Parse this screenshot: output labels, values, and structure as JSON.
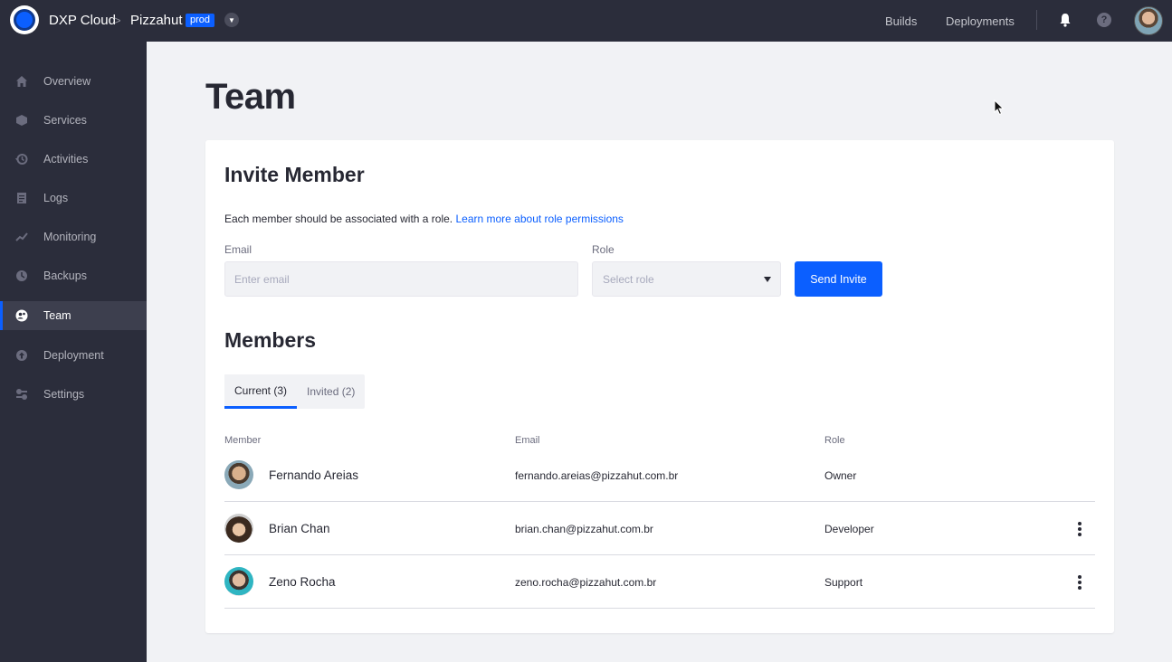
{
  "topbar": {
    "brand": "DXP Cloud",
    "separator": ">",
    "project": "Pizzahut",
    "env_badge": "prod",
    "links": [
      "Builds",
      "Deployments"
    ],
    "help_glyph": "?"
  },
  "sidebar": {
    "items": [
      {
        "label": "Overview",
        "icon": "home-icon"
      },
      {
        "label": "Services",
        "icon": "cube-icon"
      },
      {
        "label": "Activities",
        "icon": "history-icon"
      },
      {
        "label": "Logs",
        "icon": "list-icon"
      },
      {
        "label": "Monitoring",
        "icon": "chart-line-icon"
      },
      {
        "label": "Backups",
        "icon": "backup-icon"
      },
      {
        "label": "Team",
        "icon": "team-icon",
        "active": true
      },
      {
        "label": "Deployment",
        "icon": "upload-icon"
      },
      {
        "label": "Settings",
        "icon": "settings-icon"
      }
    ]
  },
  "page": {
    "title": "Team"
  },
  "invite": {
    "title": "Invite Member",
    "help_text": "Each member should be associated with a role.",
    "help_link": "Learn more about role permissions",
    "email_label": "Email",
    "email_placeholder": "Enter email",
    "role_label": "Role",
    "role_placeholder": "Select role",
    "send_label": "Send Invite"
  },
  "members": {
    "title": "Members",
    "tabs": [
      {
        "label": "Current (3)",
        "active": true
      },
      {
        "label": "Invited (2)",
        "active": false
      }
    ],
    "columns": [
      "Member",
      "Email",
      "Role"
    ],
    "rows": [
      {
        "name": "Fernando Areias",
        "email": "fernando.areias@pizzahut.com.br",
        "role": "Owner",
        "has_menu": false
      },
      {
        "name": "Brian Chan",
        "email": "brian.chan@pizzahut.com.br",
        "role": "Developer",
        "has_menu": true
      },
      {
        "name": "Zeno Rocha",
        "email": "zeno.rocha@pizzahut.com.br",
        "role": "Support",
        "has_menu": true
      }
    ]
  },
  "colors": {
    "accent": "#0b5fff",
    "sidebar_bg": "#2b2d3b",
    "page_bg": "#f1f2f5"
  }
}
